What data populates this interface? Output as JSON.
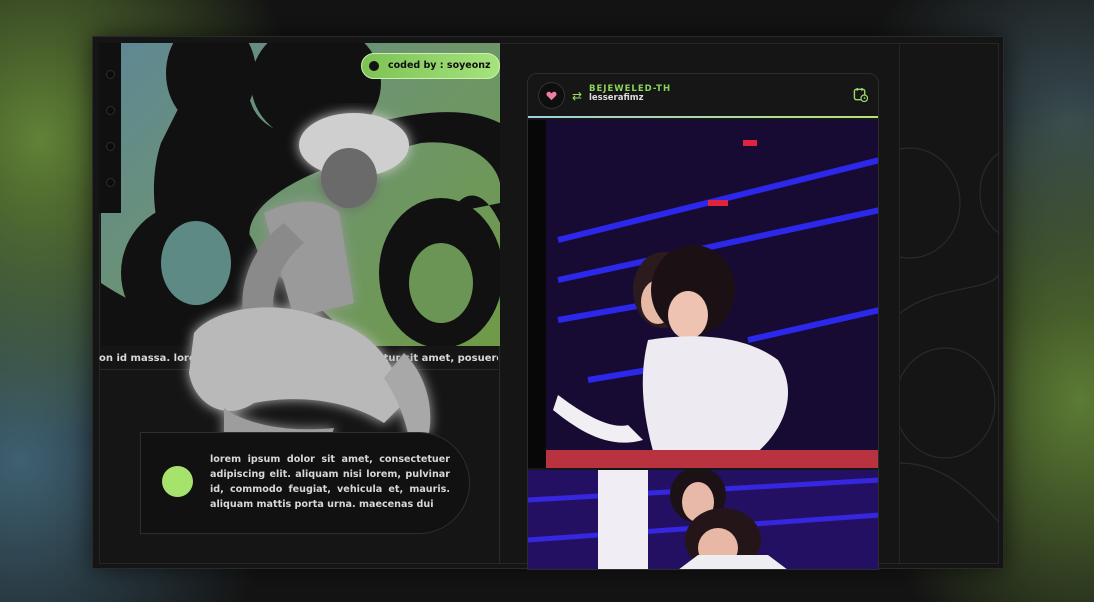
{
  "badge": {
    "label": "coded by : soyeonz"
  },
  "hero": {
    "scroll_text": "on id massa. lorem ipsum dolor sit amet, consectetur sit amet, posuere id libero sum dolor"
  },
  "card": {
    "body": "lorem ipsum dolor sit amet, consectetuer adipiscing elit. aliquam nisi lorem, pulvinar id, commodo feugiat, vehicula et, mauris. aliquam mattis porta urna. maecenas dui"
  },
  "post": {
    "author": "BEJEWELED-TH",
    "handle": "lesserafimz",
    "avatar_icon": "heart-icon",
    "reblog_icon": "reblog-icon",
    "action_icon": "calendar-clock-icon"
  },
  "colors": {
    "accent": "#a6e36c",
    "background": "#151515",
    "stage": "#2b1ee8"
  }
}
